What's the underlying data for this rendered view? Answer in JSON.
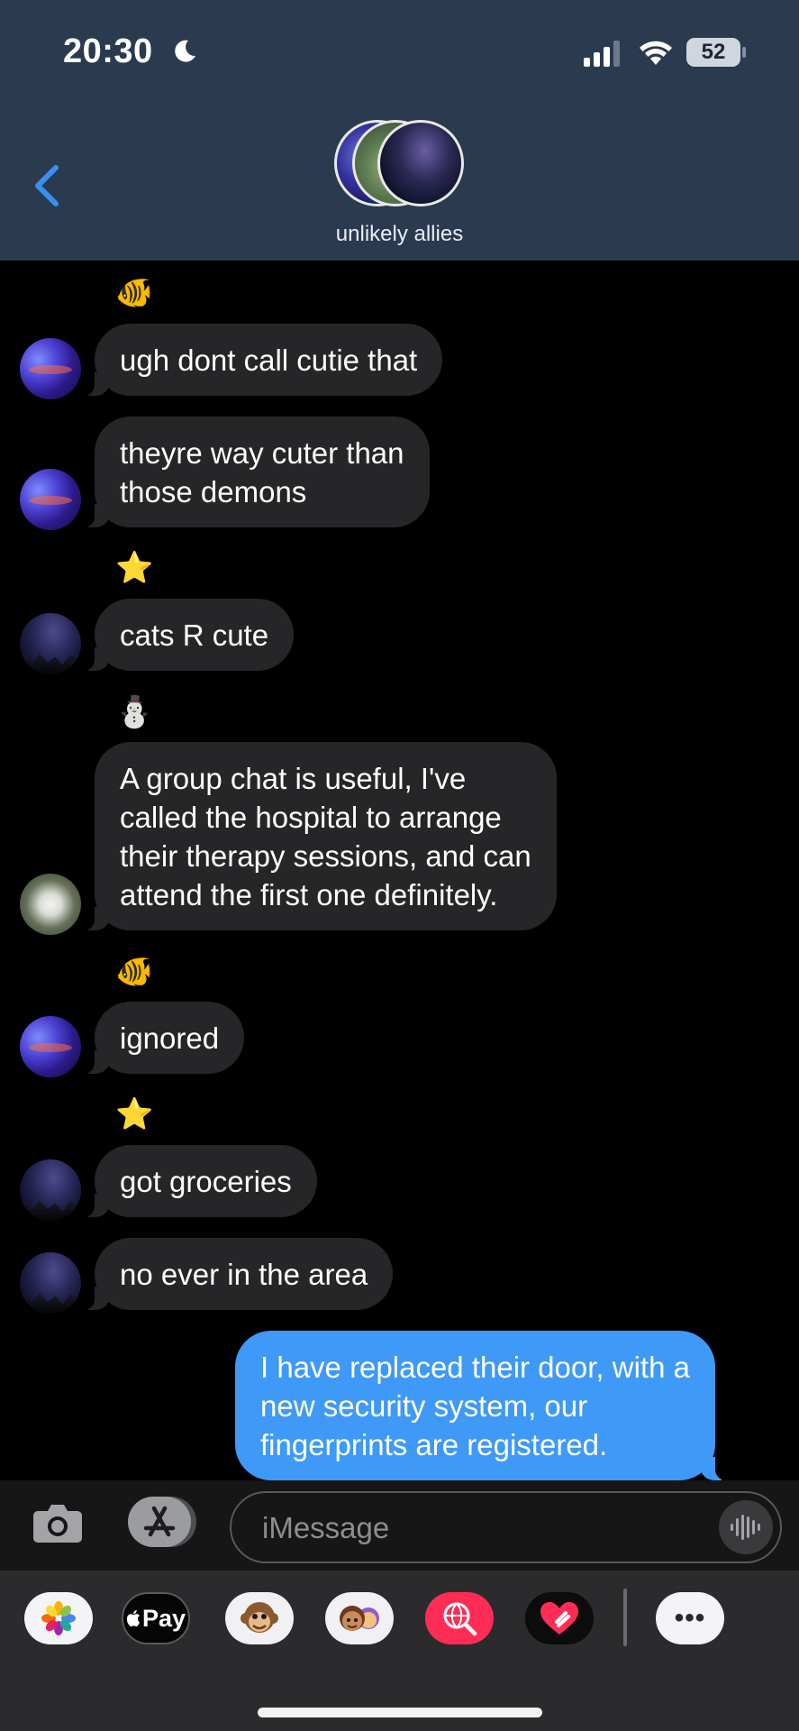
{
  "status_bar": {
    "time": "20:30",
    "battery": "52"
  },
  "header": {
    "group_name": "unlikely allies"
  },
  "messages": [
    {
      "text": "ugh dont call cutie that"
    },
    {
      "text": "theyre way cuter than\nthose demons"
    },
    {
      "text": "cats R cute"
    },
    {
      "text": "A group chat is useful, I've\ncalled the hospital to arrange\ntheir therapy sessions, and can\nattend the first one definitely."
    },
    {
      "text": "ignored"
    },
    {
      "text": "got groceries"
    },
    {
      "text": "no ever in the area"
    },
    {
      "text": "I have replaced their door, with a\nnew security system, our\nfingerprints are registered."
    }
  ],
  "sender_emojis": {
    "fish": "🐠",
    "star": "⭐",
    "snowman": "⛄"
  },
  "input": {
    "placeholder": "iMessage"
  },
  "apps": {
    "apple_pay_label": "Pay",
    "more": "•••"
  },
  "colors": {
    "header_bg": "#2a3a4f",
    "incoming_bubble": "#262628",
    "outgoing_bubble": "#3f99f7",
    "accent": "#3b8ff0"
  }
}
